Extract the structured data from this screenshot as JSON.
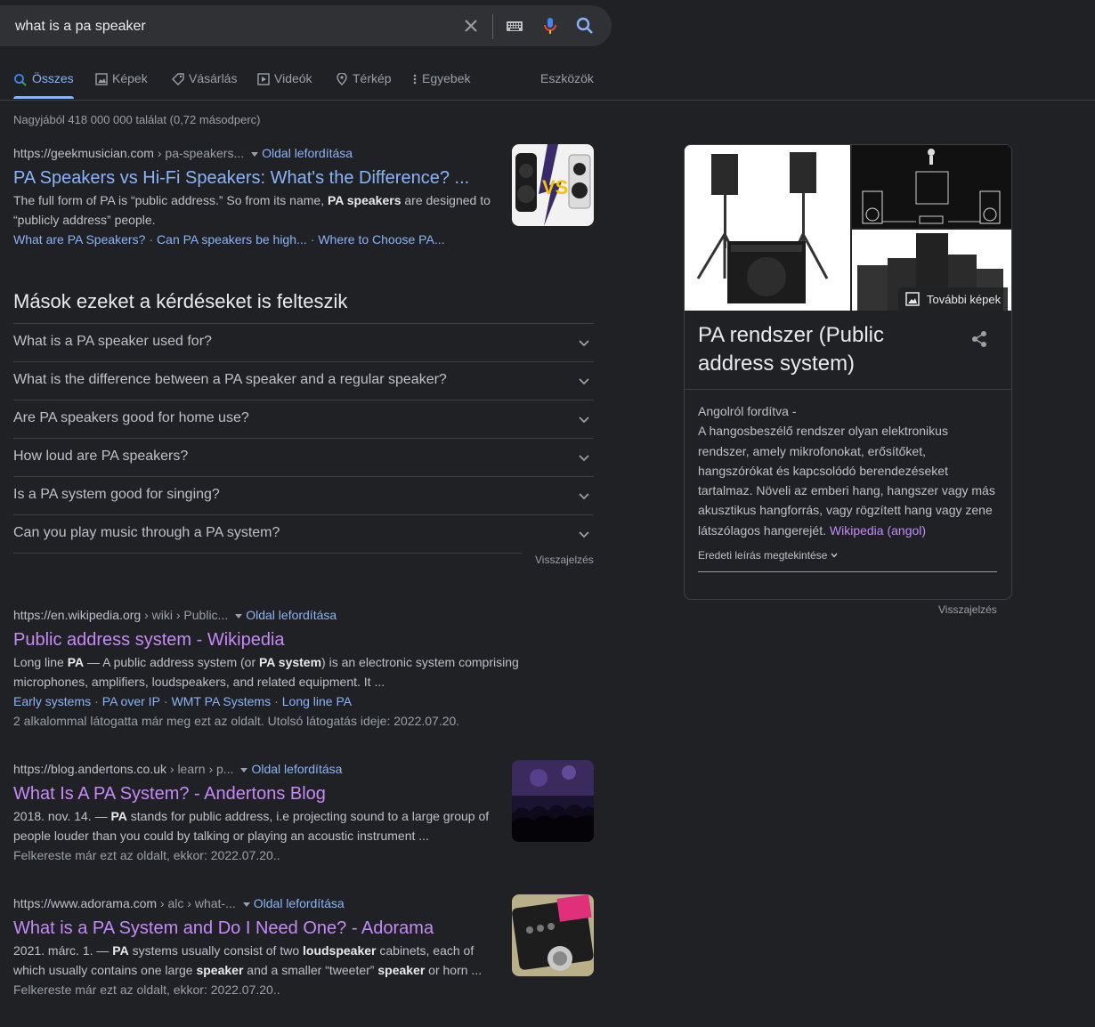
{
  "search": {
    "query": "what is a pa speaker"
  },
  "tabs": [
    {
      "label": "Összes",
      "icon": "search-icon"
    },
    {
      "label": "Képek",
      "icon": "image-icon"
    },
    {
      "label": "Vásárlás",
      "icon": "tag-icon"
    },
    {
      "label": "Videók",
      "icon": "video-icon"
    },
    {
      "label": "Térkép",
      "icon": "map-pin-icon"
    },
    {
      "label": "Egyebek",
      "icon": "more-vert-icon"
    }
  ],
  "tools_label": "Eszközök",
  "stats": "Nagyjából 418 000 000 találat (0,72 másodperc)",
  "translate_label": "Oldal lefordítása",
  "results": [
    {
      "domain": "https://geekmusician.com",
      "crumbs": " › pa-speakers...",
      "title": "PA Speakers vs Hi-Fi Speakers: What's the Difference? ...",
      "snippet_html": "The full form of PA is “public address.” So from its name, <b>PA speakers</b> are designed to “publicly address” people.",
      "sitelinks": [
        "What are PA Speakers?",
        "Can PA speakers be high...",
        "Where to Choose PA..."
      ]
    },
    {
      "domain": "https://en.wikipedia.org",
      "crumbs": " › wiki › Public...",
      "title": "Public address system - Wikipedia",
      "snippet_html": "Long line <b>PA</b> — A public address system (or <b>PA system</b>) is an electronic system comprising microphones, amplifiers, loudspeakers, and related equipment. It ...",
      "sitelinks": [
        "Early systems",
        "PA over IP",
        "WMT PA Systems",
        "Long line PA"
      ],
      "visit_note": "2 alkalommal látogatta már meg ezt az oldalt. Utolsó látogatás ideje: 2022.07.20."
    },
    {
      "domain": "https://blog.andertons.co.uk",
      "crumbs": " › learn › p...",
      "title": "What Is A PA System? - Andertons Blog",
      "snippet_html": "2018. nov. 14. — <b>PA</b> stands for public address, i.e projecting sound to a large group of people louder than you could by talking or playing an acoustic instrument ...",
      "visit_note": "Felkereste már ezt az oldalt, ekkor: 2022.07.20.."
    },
    {
      "domain": "https://www.adorama.com",
      "crumbs": " › alc › what-...",
      "title": "What is a PA System and Do I Need One? - Adorama",
      "snippet_html": "2021. márc. 1. — <b>PA</b> systems usually consist of two <b>loudspeaker</b> cabinets, each of which usually contains one large <b>speaker</b> and a smaller “tweeter” <b>speaker</b> or horn ...",
      "visit_note": "Felkereste már ezt az oldalt, ekkor: 2022.07.20.."
    }
  ],
  "paa": {
    "title": "Mások ezeket a kérdéseket is felteszik",
    "questions": [
      "What is a PA speaker used for?",
      "What is the difference between a PA speaker and a regular speaker?",
      "Are PA speakers good for home use?",
      "How loud are PA speakers?",
      "Is a PA system good for singing?",
      "Can you play music through a PA system?"
    ],
    "feedback": "Visszajelzés"
  },
  "knowledge_panel": {
    "more_images": "További képek",
    "title": "PA rendszer (Public address system)",
    "translated_from": "Angolról fordítva -",
    "description": "A hangosbeszélő rendszer olyan elektronikus rendszer, amely mikrofonokat, erősítőket, hangszórókat és kapcsolódó berendezéseket tartalmaz. Növeli az emberi hang, hangszer vagy más akusztikus hangforrás, vagy rögzített hang vagy zene látszólagos hangerejét.",
    "source_link": "Wikipedia (angol)",
    "original_label": "Eredeti leírás megtekintése",
    "feedback": "Visszajelzés"
  },
  "colors": {
    "background": "#202124",
    "link": "#8ab4f8",
    "visited": "#c58af9",
    "text": "#bdc1c6"
  }
}
